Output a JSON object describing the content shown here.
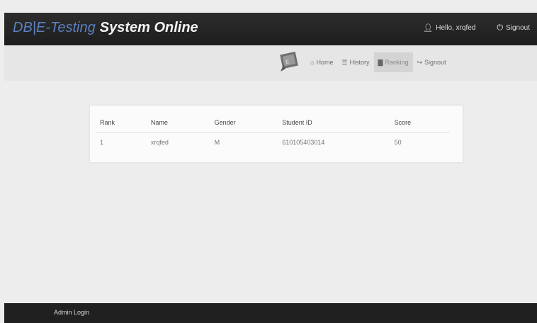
{
  "header": {
    "brand_prefix": "DB|E-Testing",
    "brand_main": "System Online",
    "greeting": "Hello, xrqfed",
    "signout_label": "Signout"
  },
  "nav": {
    "items": [
      {
        "icon": "home-icon",
        "label": "Home"
      },
      {
        "icon": "history-icon",
        "label": "History"
      },
      {
        "icon": "ranking-icon",
        "label": "Ranking"
      },
      {
        "icon": "signout-icon",
        "label": "Signout"
      }
    ],
    "active": "Ranking"
  },
  "ranking": {
    "columns": [
      "Rank",
      "Name",
      "Gender",
      "Student ID",
      "Score"
    ],
    "rows": [
      [
        "1",
        "xrqfed",
        "M",
        "610105403014",
        "50"
      ]
    ]
  },
  "footer": {
    "admin_login": "Admin Login"
  },
  "colors": {
    "header_bg": "#1d1d1d",
    "brand_prefix": "#5b7fbf",
    "page_bg": "#ededed",
    "footer_bg": "#202020"
  }
}
